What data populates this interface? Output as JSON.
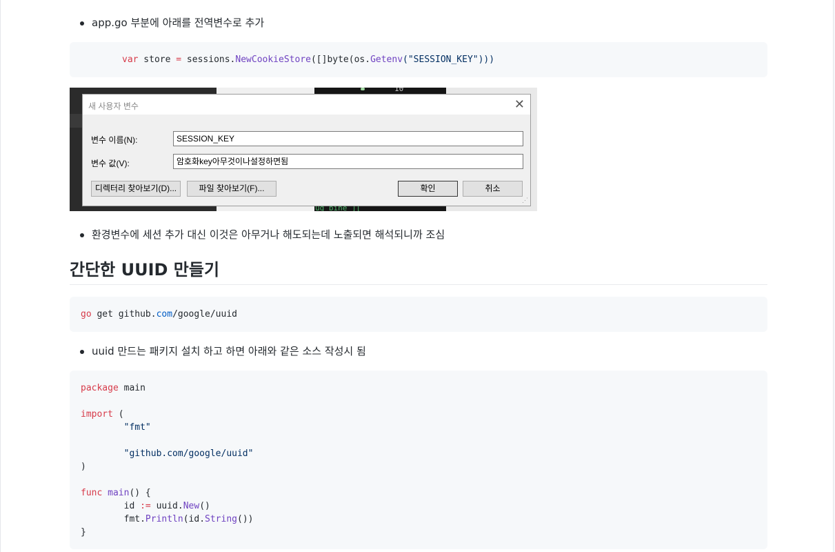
{
  "bullets": {
    "b1": "app.go 부분에 아래를 전역변수로 추가",
    "b2": "환경변수에 세션 추가 대신 이것은 아무거나 해도되는데 노출되면 해석되니까 조심",
    "b3": "uuid 만드는 패키지 설치 하고 하면 아래와 같은 소스 작성시 됨"
  },
  "code1": {
    "t1": "var",
    "t2": " store ",
    "t3": "=",
    "t4": " sessions.",
    "t5": "NewCookieStore",
    "t6": "([]byte(os.",
    "t7": "Getenv",
    "t8": "(\"SESSION_KEY\")))"
  },
  "heading": "간단한 UUID 만들기",
  "code2": {
    "t1": "go",
    "t2": " get github.",
    "t3": "com",
    "t4": "/google/uuid"
  },
  "code3": {
    "l1a": "package",
    "l1b": " main",
    "l3a": "import",
    "l3b": " (",
    "l4": "        \"fmt\"",
    "l6": "        \"github.com/google/uuid\"",
    "l7": ")",
    "l9a": "func",
    "l9b": " main",
    "l9c": "() {",
    "l10a": "        id ",
    "l10b": ":=",
    "l10c": " uuid.",
    "l10d": "New",
    "l10e": "()",
    "l11a": "        fmt.",
    "l11b": "Println",
    "l11c": "(id.",
    "l11d": "String",
    "l11e": "())",
    "l12": "}"
  },
  "screenshot": {
    "term_top": "10",
    "term_bottom": "ug bine  ]["
  },
  "dialog": {
    "title": "새 사용자 변수",
    "close_glyph": "✕",
    "name_label": "변수 이름(N):",
    "name_value": "SESSION_KEY",
    "value_label": "변수 값(V):",
    "value_value": "암호화key아무것이나설정하면됨",
    "browse_dir": "디렉터리 찾아보기(D)...",
    "browse_file": "파일 찾아보기(F)...",
    "ok": "확인",
    "cancel": "취소",
    "grip": "⋰"
  },
  "colors": {
    "keyword": "#d73a49",
    "function": "#6f42c1",
    "package": "#005cc5",
    "string": "#032f62",
    "code_bg": "#f6f8fa"
  }
}
